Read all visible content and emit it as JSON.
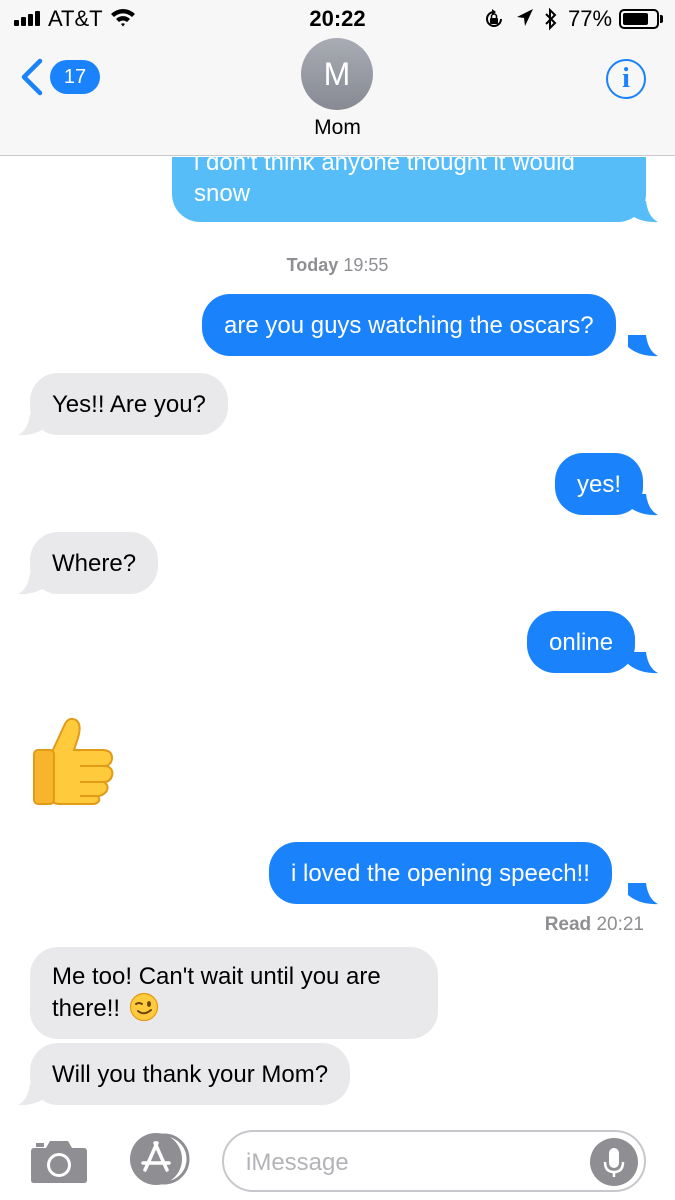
{
  "status_bar": {
    "carrier": "AT&T",
    "time": "20:22",
    "battery_percent": "77%",
    "battery_level": 0.77
  },
  "header": {
    "back_badge": "17",
    "avatar_initial": "M",
    "contact_name": "Mom",
    "info_glyph": "i"
  },
  "conversation": {
    "messages": [
      {
        "type": "sent",
        "text": "i don't think anyone thought it would snow"
      },
      {
        "type": "timestamp",
        "bold": "Today",
        "rest": " 19:55"
      },
      {
        "type": "sent",
        "text": "are you guys watching the oscars?"
      },
      {
        "type": "received",
        "text": "Yes!! Are you?"
      },
      {
        "type": "sent",
        "text": "yes!"
      },
      {
        "type": "received",
        "text": "Where?"
      },
      {
        "type": "sent",
        "text": "online"
      },
      {
        "type": "received_emoji",
        "emoji": "thumbs-up"
      },
      {
        "type": "sent",
        "text": "i loved the opening speech!!"
      },
      {
        "type": "status",
        "bold": "Read",
        "rest": " 20:21"
      },
      {
        "type": "received",
        "text": "Me too! Can't wait until you are there!!",
        "emoji": "winking-face"
      },
      {
        "type": "received",
        "text": "Will you thank your Mom?"
      }
    ]
  },
  "input_bar": {
    "placeholder": "iMessage"
  },
  "colors": {
    "accent": "#1a82fb",
    "sent_bubble": "#1a82fb",
    "received_bubble": "#e9e9eb",
    "secondary_text": "#8e8e93"
  },
  "icons": [
    "signal-icon",
    "wifi-icon",
    "rotation-lock-icon",
    "location-icon",
    "bluetooth-icon",
    "battery-icon",
    "chevron-left-icon",
    "info-icon",
    "thumbs-up-icon",
    "winking-face-icon",
    "camera-icon",
    "app-store-icon",
    "microphone-icon"
  ]
}
